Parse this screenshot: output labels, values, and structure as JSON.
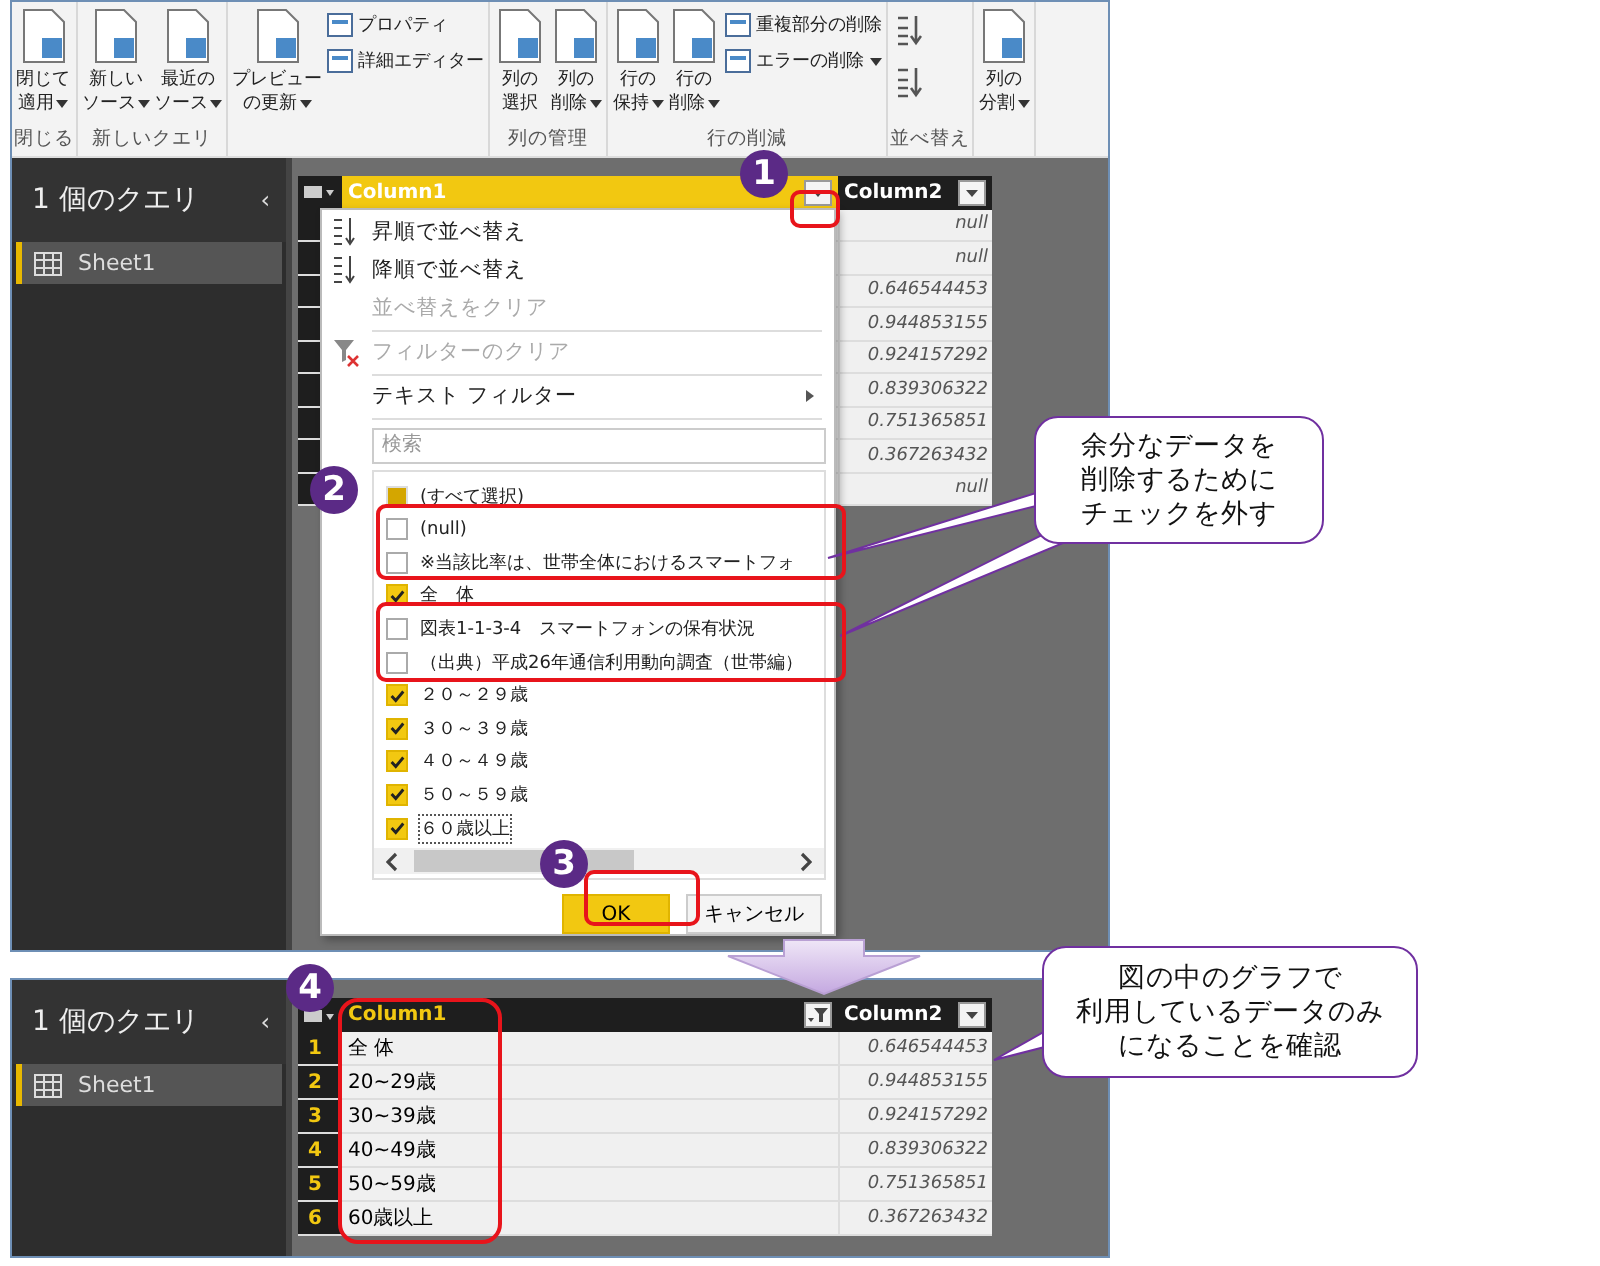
{
  "ribbon": {
    "groups": [
      {
        "label": "閉じる",
        "buttons": [
          {
            "kind": "large",
            "lines": [
              "閉じて",
              "適用"
            ],
            "dropdown": true
          }
        ]
      },
      {
        "label": "新しいクエリ",
        "buttons": [
          {
            "kind": "large",
            "lines": [
              "新しい",
              "ソース"
            ],
            "dropdown": true
          },
          {
            "kind": "large",
            "lines": [
              "最近の",
              "ソース"
            ],
            "dropdown": true
          }
        ]
      },
      {
        "buttons": [
          {
            "kind": "large",
            "lines": [
              "プレビュー",
              "の更新"
            ],
            "dropdown": true
          },
          {
            "kind": "small",
            "lines": [
              "プロパティ"
            ],
            "dropdown": false
          },
          {
            "kind": "small",
            "lines": [
              "詳細エディター"
            ],
            "dropdown": false
          }
        ]
      },
      {
        "label": "列の管理",
        "buttons": [
          {
            "kind": "large",
            "lines": [
              "列の",
              "選択"
            ],
            "dropdown": false
          },
          {
            "kind": "large",
            "lines": [
              "列の",
              "削除"
            ],
            "dropdown": true
          }
        ]
      },
      {
        "label": "行の削減",
        "buttons": [
          {
            "kind": "large",
            "lines": [
              "行の",
              "保持"
            ],
            "dropdown": true
          },
          {
            "kind": "large",
            "lines": [
              "行の",
              "削除"
            ],
            "dropdown": true
          },
          {
            "kind": "small",
            "lines": [
              "重複部分の削除"
            ],
            "dropdown": false
          },
          {
            "kind": "small",
            "lines": [
              "エラーの削除"
            ],
            "dropdown": true
          }
        ]
      },
      {
        "label": "並べ替え",
        "buttons": [
          {
            "kind": "icon"
          },
          {
            "kind": "icon"
          }
        ]
      },
      {
        "buttons": [
          {
            "kind": "large",
            "lines": [
              "列の",
              "分割"
            ],
            "dropdown": true
          }
        ]
      }
    ]
  },
  "top": {
    "queries": {
      "title": "1 個のクエリ",
      "collapse": "‹",
      "items": [
        {
          "label": "Sheet1",
          "selected": true
        }
      ]
    },
    "table": {
      "columns": [
        {
          "label": "Column1",
          "selected": true
        },
        {
          "label": "Column2",
          "selected": false
        }
      ],
      "rows": [
        {
          "column_2": "null"
        },
        {
          "column_2": "null"
        },
        {
          "column_2": "0.646544453"
        },
        {
          "column_2": "0.944853155"
        },
        {
          "column_2": "0.924157292"
        },
        {
          "column_2": "0.839306322"
        },
        {
          "column_2": "0.751365851"
        },
        {
          "column_2": "0.367263432"
        },
        {
          "column_2": "null"
        }
      ]
    },
    "filter_menu": {
      "items": [
        {
          "kind": "sort_asc",
          "label": "昇順で並べ替え",
          "disabled": false
        },
        {
          "kind": "sort_desc",
          "label": "降順で並べ替え",
          "disabled": false
        },
        {
          "kind": "plain",
          "label": "並べ替えをクリア",
          "disabled": true
        },
        {
          "kind": "clear_filter",
          "label": "フィルターのクリア",
          "disabled": true
        },
        {
          "kind": "submenu",
          "label": "テキスト フィルター",
          "disabled": false
        }
      ],
      "search": {
        "placeholder": "検索"
      },
      "values": [
        {
          "label": "(すべて選択)",
          "checked": false,
          "partial": true,
          "focused": false
        },
        {
          "label": "(null)",
          "checked": false,
          "partial": false,
          "focused": false
        },
        {
          "label": "※当該比率は、世帯全体におけるスマートフォ",
          "checked": false,
          "partial": false,
          "focused": false
        },
        {
          "label": "全　体",
          "checked": true,
          "partial": false,
          "focused": false
        },
        {
          "label": "図表1-1-3-4　スマートフォンの保有状況",
          "checked": false,
          "partial": false,
          "focused": false
        },
        {
          "label": "（出典）平成26年通信利用動向調査（世帯編）",
          "checked": false,
          "partial": false,
          "focused": false
        },
        {
          "label": "２０～２９歳",
          "checked": true,
          "partial": false,
          "focused": false
        },
        {
          "label": "３０～３９歳",
          "checked": true,
          "partial": false,
          "focused": false
        },
        {
          "label": "４０～４９歳",
          "checked": true,
          "partial": false,
          "focused": false
        },
        {
          "label": "５０～５９歳",
          "checked": true,
          "partial": false,
          "focused": false
        },
        {
          "label": "６０歳以上",
          "checked": true,
          "partial": false,
          "focused": true
        }
      ],
      "buttons": [
        {
          "label": "OK",
          "primary": true
        },
        {
          "label": "キャンセル",
          "primary": false
        }
      ]
    }
  },
  "bottom": {
    "queries": {
      "title": "1 個のクエリ",
      "collapse": "‹",
      "items": [
        {
          "label": "Sheet1",
          "selected": true
        }
      ]
    },
    "table": {
      "columns": [
        {
          "label": "Column1",
          "filtered": true
        },
        {
          "label": "Column2",
          "filtered": false
        }
      ],
      "rows": [
        {
          "index": "1",
          "column_1": "全 体",
          "column_2": "0.646544453"
        },
        {
          "index": "2",
          "column_1": "20~29歳",
          "column_2": "0.944853155"
        },
        {
          "index": "3",
          "column_1": "30~39歳",
          "column_2": "0.924157292"
        },
        {
          "index": "4",
          "column_1": "40~49歳",
          "column_2": "0.839306322"
        },
        {
          "index": "5",
          "column_1": "50~59歳",
          "column_2": "0.751365851"
        },
        {
          "index": "6",
          "column_1": "60歳以上",
          "column_2": "0.367263432"
        }
      ]
    }
  },
  "badges": [
    "1",
    "2",
    "3",
    "4"
  ],
  "callouts": [
    {
      "lines": [
        "余分なデータを",
        "削除するために",
        "チェックを外す"
      ]
    },
    {
      "lines": [
        "図の中のグラフで",
        "利用しているデータのみ",
        "になることを確認"
      ]
    }
  ]
}
